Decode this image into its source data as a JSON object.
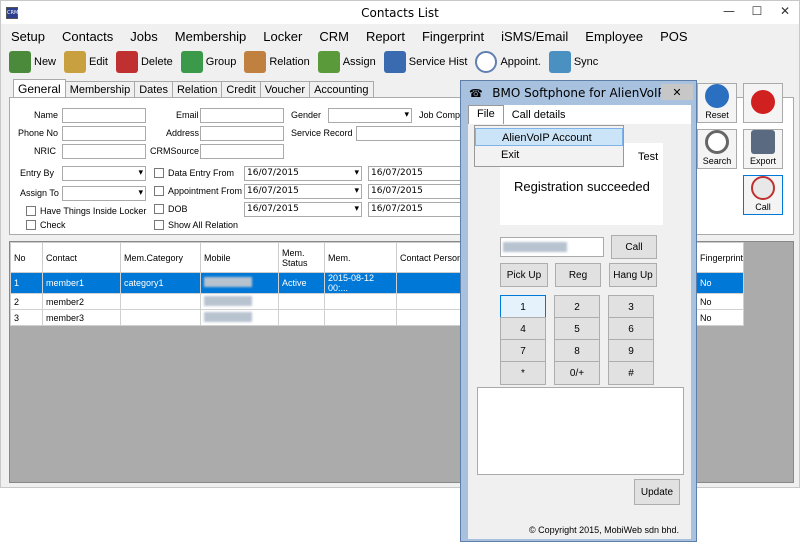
{
  "window": {
    "title": "Contacts List",
    "app_icon": "CRM"
  },
  "menu": [
    "Setup",
    "Contacts",
    "Jobs",
    "Membership",
    "Locker",
    "CRM",
    "Report",
    "Fingerprint",
    "iSMS/Email",
    "Employee",
    "POS"
  ],
  "toolbar": [
    {
      "label": "New",
      "icon": "person-add-icon",
      "color": "#4a8a3a"
    },
    {
      "label": "Edit",
      "icon": "person-edit-icon",
      "color": "#c8a040"
    },
    {
      "label": "Delete",
      "icon": "person-delete-icon",
      "color": "#c03030"
    },
    {
      "label": "Group",
      "icon": "group-icon",
      "color": "#3a9a4a"
    },
    {
      "label": "Relation",
      "icon": "relation-icon",
      "color": "#c08040"
    },
    {
      "label": "Assign",
      "icon": "assign-icon",
      "color": "#5a9a3a"
    },
    {
      "label": "Service Hist",
      "icon": "service-history-icon",
      "color": "#3a6ab0"
    },
    {
      "label": "Appoint.",
      "icon": "clock-icon",
      "color": "#6080b0"
    },
    {
      "label": "Sync",
      "icon": "sync-icon",
      "color": "#4a90c0"
    }
  ],
  "tabs": [
    "General",
    "Membership",
    "Dates",
    "Relation",
    "Credit",
    "Voucher",
    "Accounting"
  ],
  "form": {
    "name": "Name",
    "phone": "Phone No",
    "nric": "NRIC",
    "email": "Email",
    "address": "Address",
    "crmsource": "CRMSource",
    "gender": "Gender",
    "job_company": "Job Compan",
    "service_record": "Service Record",
    "entry_by": "Entry By",
    "assign_to": "Assign To",
    "have_things": "Have Things Inside Locker",
    "check": "Check",
    "data_entry_from": "Data Entry From",
    "appointment_from": "Appointment From",
    "dob": "DOB",
    "show_all_relation": "Show All Relation",
    "date1_from": "16/07/2015",
    "date1_to": "16/07/2015",
    "date2_from": "16/07/2015",
    "date2_to": "16/07/2015",
    "date3_from": "16/07/2015",
    "date3_to": "16/07/2015"
  },
  "right_buttons": {
    "reset": "Reset",
    "search": "Search",
    "export": "Export",
    "call": "Call"
  },
  "table": {
    "headers": [
      "No",
      "Contact",
      "Mem.Category",
      "Mobile",
      "Mem. Status",
      "Mem.",
      "Contact Person",
      "Fingerprint"
    ],
    "rows": [
      {
        "no": "1",
        "contact": "member1",
        "category": "category1",
        "status": "Active",
        "mem": "2015-08-12 00:...",
        "fingerprint": "No"
      },
      {
        "no": "2",
        "contact": "member2",
        "category": "",
        "status": "",
        "mem": "",
        "fingerprint": "No"
      },
      {
        "no": "3",
        "contact": "member3",
        "category": "",
        "status": "",
        "mem": "",
        "fingerprint": "No"
      }
    ]
  },
  "softphone": {
    "title": "BMO Softphone for AlienVoIP",
    "menu_file": "File",
    "menu_call_details": "Call details",
    "dropdown": [
      "AlienVoIP Account",
      "Exit"
    ],
    "test": "Test",
    "status": "Registration succeeded",
    "call": "Call",
    "pickup": "Pick Up",
    "reg": "Reg",
    "hangup": "Hang Up",
    "keys": [
      "1",
      "2",
      "3",
      "4",
      "5",
      "6",
      "7",
      "8",
      "9",
      "*",
      "0/+",
      "#"
    ],
    "update": "Update",
    "copyright": "© Copyright 2015, MobiWeb sdn bhd."
  }
}
